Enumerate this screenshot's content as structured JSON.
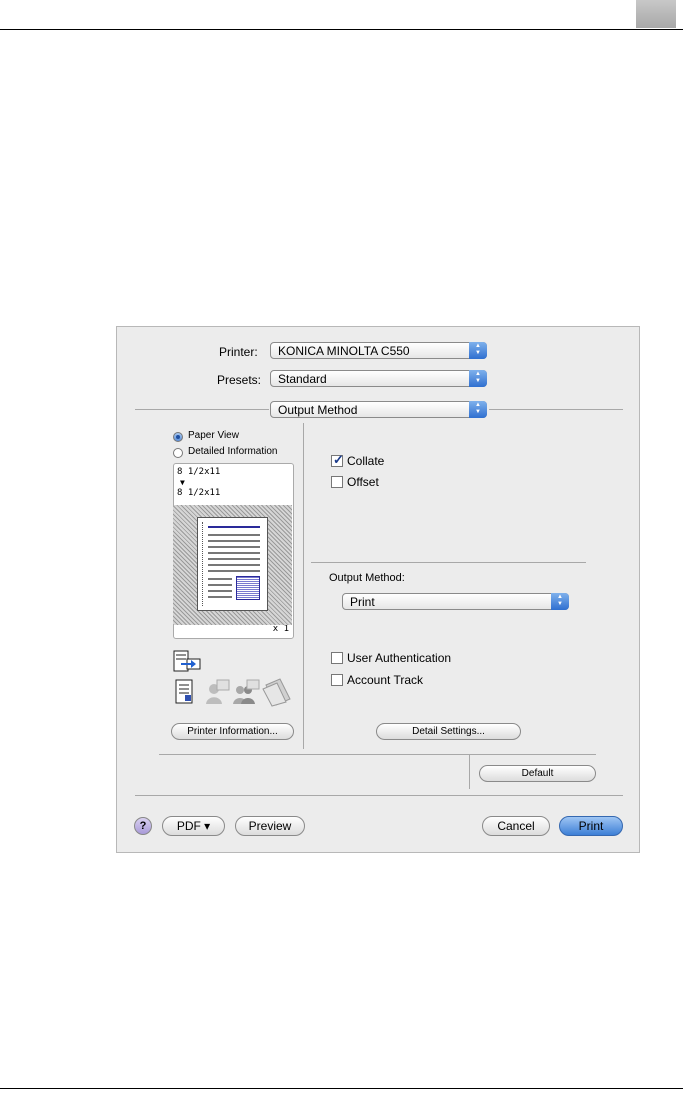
{
  "dialog": {
    "printer_label": "Printer:",
    "printer_value": "KONICA MINOLTA C550",
    "presets_label": "Presets:",
    "presets_value": "Standard",
    "panel_value": "Output Method",
    "view_options": [
      {
        "label": "Paper View",
        "selected": true
      },
      {
        "label": "Detailed Information",
        "selected": false
      }
    ],
    "preview": {
      "paper_from": "8 1/2x11",
      "arrow": "▼",
      "paper_to": "8 1/2x11",
      "copies": "x 1"
    },
    "printer_info_button": "Printer Information...",
    "collate_label": "Collate",
    "collate_checked": true,
    "offset_label": "Offset",
    "offset_checked": false,
    "output_method_label": "Output Method:",
    "output_method_value": "Print",
    "user_auth_label": "User Authentication",
    "user_auth_checked": false,
    "account_track_label": "Account Track",
    "account_track_checked": false,
    "detail_settings_button": "Detail Settings...",
    "default_button": "Default",
    "help_glyph": "?",
    "pdf_button": "PDF ▾",
    "preview_button": "Preview",
    "cancel_button": "Cancel",
    "print_button": "Print"
  },
  "colors": {
    "accent": "#3d7fd6",
    "dialog_bg": "#ececec"
  }
}
